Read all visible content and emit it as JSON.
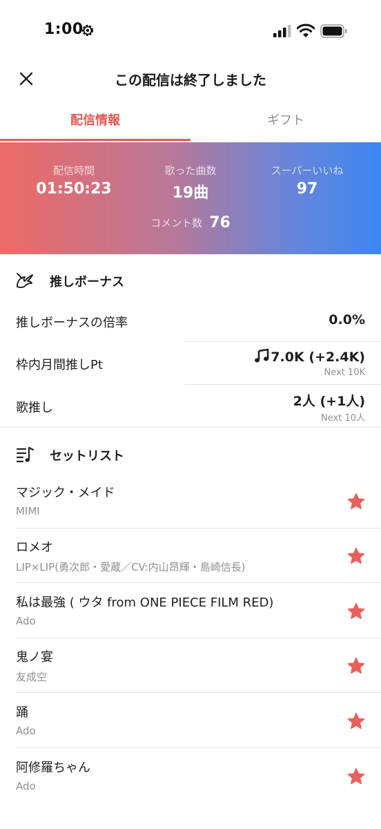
{
  "status_bar": {
    "time": "1:00"
  },
  "header": {
    "title": "この配信は終了しました"
  },
  "tabs": [
    {
      "label": "配信情報",
      "active": true
    },
    {
      "label": "ギフト",
      "active": false
    }
  ],
  "stats": {
    "duration_label": "配信時間",
    "duration_value": "01:50:23",
    "songs_label": "歌った曲数",
    "songs_value": "19曲",
    "likes_label": "スーパーいいね",
    "likes_value": "97",
    "comments_label": "コメント数",
    "comments_value": "76"
  },
  "bonus": {
    "title": "推しボーナス",
    "multiplier_label": "推しボーナスの倍率",
    "multiplier_value": "0.0%",
    "monthly_label": "枠内月間推しPt",
    "monthly_value": "7.0K (+2.4K)",
    "monthly_next": "Next 10K",
    "song_label": "歌推し",
    "song_value": "2人 (+1人)",
    "song_next": "Next 10人"
  },
  "setlist": {
    "title": "セットリスト",
    "songs": [
      {
        "title": "マジック・メイド",
        "artist": "MIMI"
      },
      {
        "title": "ロメオ",
        "artist": "LIP×LIP(勇次郎・愛蔵／CV:内山昂輝・島崎信長)"
      },
      {
        "title": "私は最強 ( ウタ from ONE PIECE FILM RED)",
        "artist": "Ado"
      },
      {
        "title": "鬼ノ宴",
        "artist": "友成空"
      },
      {
        "title": "踊",
        "artist": "Ado"
      },
      {
        "title": "阿修羅ちゃん",
        "artist": "Ado"
      }
    ]
  },
  "colors": {
    "accent": "#e55a54",
    "star": "#e8605c",
    "gradient_start": "#ee6a66",
    "gradient_end": "#3d86f2"
  }
}
